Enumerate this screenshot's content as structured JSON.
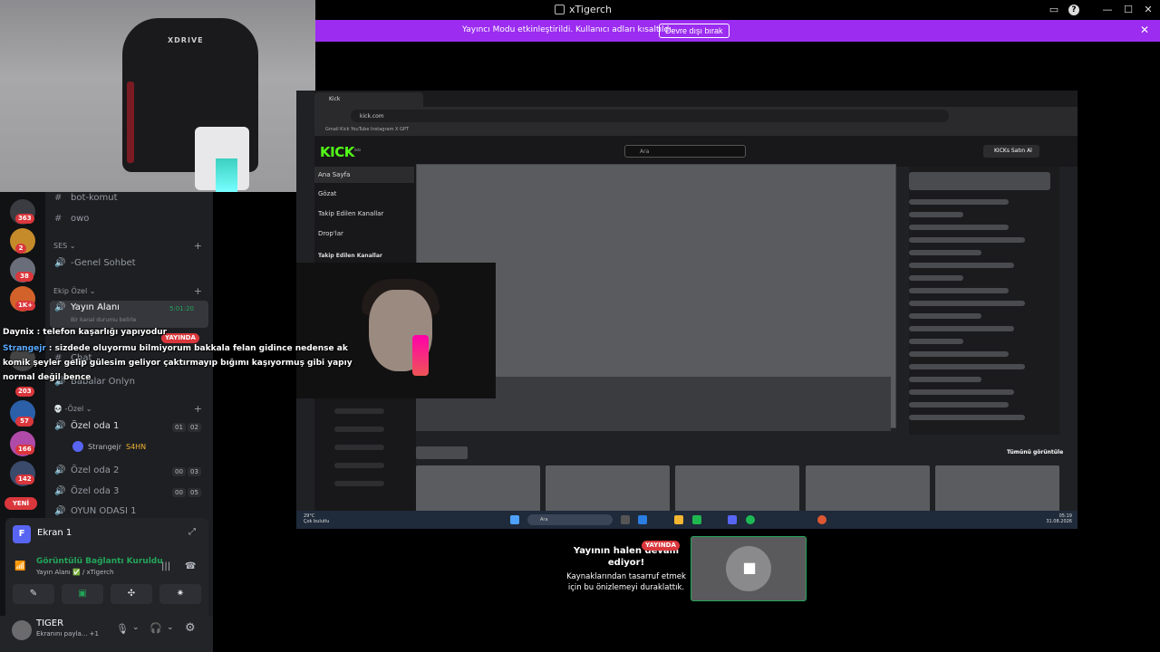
{
  "window": {
    "title": "xTigerch"
  },
  "banner": {
    "message": "Yayıncı Modu etkinleştirildi. Kullanıcı adları kısaltıldı.",
    "disable_label": "Devre dışı bırak",
    "bg_color": "#9b2cf0"
  },
  "webcam": {
    "chair_brand": "XDRIVE"
  },
  "servers": {
    "badges": [
      "363",
      "2",
      "38",
      "1K+",
      "203",
      "57",
      "166",
      "142"
    ],
    "new_label": "YENİ"
  },
  "channels": {
    "bot_komut": "bot-komut",
    "owo": "owo",
    "cat_ses": "SES",
    "genel_sohbet": "-Genel Sohbet",
    "cat_ekip": "Ekip Özel",
    "yayin_alani": "Yayın Alanı",
    "yayin_timer": "5:01:20",
    "status_placeholder": "Bir kanal durumu belirle",
    "live_label": "YAYINDA",
    "chat_ch": "Chat",
    "babalar": "Babalar Onlyn",
    "cat_ozel": "-Özel",
    "ozel1": "Özel oda 1",
    "ozel1_counts": [
      "01",
      "02"
    ],
    "member_name": "Strangejr",
    "member_tag": "S4HN",
    "ozel2": "Özel oda 2",
    "ozel2_counts": [
      "00",
      "03"
    ],
    "ozel3": "Özel oda 3",
    "ozel3_counts": [
      "00",
      "05"
    ],
    "oyun": "OYUN ODASI 1"
  },
  "chat_overlay": {
    "line1_user": "Daynix",
    "line1_text": " : telefon kaşarlığı yapıyodur",
    "line2_user": "Strangejr",
    "line2_text": " : sizdede oluyormu bilmiyorum bakkala felan gidince nedense ak",
    "line3": "komik şeyler gelip gülesim geliyor çaktırmayıp bığımı kaşıyormuş gibi yapıy",
    "line4": "normal değil bence"
  },
  "ekran_panel": {
    "title": "Ekran 1",
    "avatar_letter": "F",
    "connection": "Görüntülü Bağlantı Kuruldu",
    "channel": "Yayın Alanı",
    "server": "/ xTigerch"
  },
  "userbar": {
    "name": "TIGER",
    "status": "Ekranını payla...",
    "extra": "+1"
  },
  "share": {
    "tab_title": "Kick",
    "url": "kick.com",
    "bookmarks": "Gmail   Kick   YouTube   Instagram   X   GPT",
    "logo": "KICK",
    "logo_beta": "beta",
    "search_placeholder": "Ara",
    "buy_label": "KICKs Satın Al",
    "nav": [
      "Ana Sayfa",
      "Gözat",
      "Takip Edilen Kanallar",
      "Drop'lar"
    ],
    "followed_header": "Takip Edilen Kanallar",
    "see_all": "Tümünü görüntüle",
    "weather_temp": "29°C",
    "weather_desc": "Çok bulutlu",
    "taskbar_search": "Ara",
    "time": "05:19",
    "date": "31.08.2026"
  },
  "paused": {
    "title": "Yayının halen devam ediyor!",
    "desc": "Kaynaklarından tasarruf etmek için bu önizlemeyi duraklattık.",
    "live_label": "YAYINDA"
  }
}
